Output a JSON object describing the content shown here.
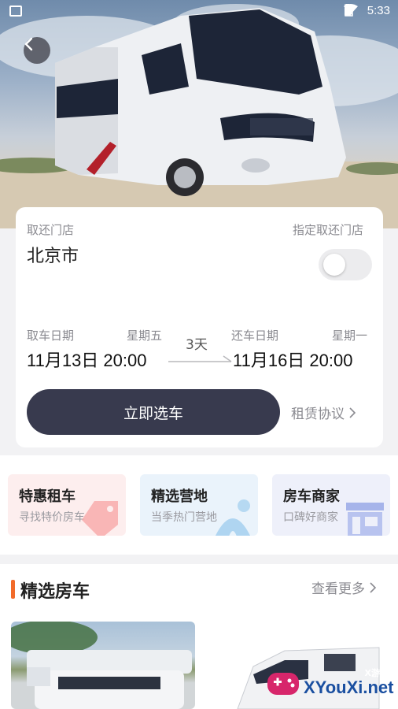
{
  "status_bar": {
    "time": "5:33"
  },
  "booking": {
    "store_label": "取还门店",
    "designate_label": "指定取还门店",
    "city": "北京市",
    "pickup_label": "取车日期",
    "pickup_weekday": "星期五",
    "pickup_datetime": "11月13日 20:00",
    "duration": "3天",
    "return_label": "还车日期",
    "return_weekday": "星期一",
    "return_datetime": "11月16日 20:00",
    "cta": "立即选车",
    "agreement": "租赁协议"
  },
  "features": [
    {
      "title": "特惠租车",
      "subtitle": "寻找特价房车",
      "color": "#fdeeee",
      "icon": "tag-icon"
    },
    {
      "title": "精选营地",
      "subtitle": "当季热门营地",
      "color": "#eaf3fb",
      "icon": "tent-icon"
    },
    {
      "title": "房车商家",
      "subtitle": "口碑好商家",
      "color": "#eef0fa",
      "icon": "store-icon"
    }
  ],
  "recommended": {
    "title": "精选房车",
    "more": "查看更多"
  },
  "watermark": {
    "small": "X游戏",
    "big": "XYouXi.net"
  },
  "colors": {
    "accent": "#f26b2a",
    "cta_bg": "#383a4e"
  }
}
